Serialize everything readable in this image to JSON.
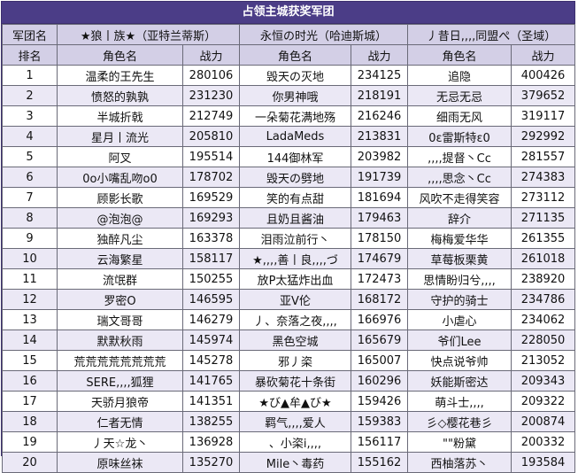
{
  "title": "占领主城获奖军团",
  "header": {
    "corps_label": "军团名",
    "teams": [
      "★狼丨族★（亚特兰蒂斯）",
      "永恒の时光（哈迪斯城）",
      "丿昔日,,,,同盟ぺ（圣域）"
    ]
  },
  "subheader": {
    "rank": "排名",
    "name": "角色名",
    "power": "战力"
  },
  "rows": [
    {
      "rank": "1",
      "a_name": "温柔的王先生",
      "a_power": "280106",
      "b_name": "毁天の灭地",
      "b_power": "234125",
      "c_name": "追隐",
      "c_power": "400426"
    },
    {
      "rank": "2",
      "a_name": "愤怒的孰孰",
      "a_power": "231230",
      "b_name": "你男神哦",
      "b_power": "218191",
      "c_name": "无忌无忌",
      "c_power": "379652"
    },
    {
      "rank": "3",
      "a_name": "半城折戟",
      "a_power": "212749",
      "b_name": "一朵菊花满地殇",
      "b_power": "216246",
      "c_name": "细雨无风",
      "c_power": "319117"
    },
    {
      "rank": "4",
      "a_name": "星月丨流光",
      "a_power": "205810",
      "b_name": "LadaMeds",
      "b_power": "213831",
      "c_name": "0ε雷斯特ε0",
      "c_power": "292992"
    },
    {
      "rank": "5",
      "a_name": "阿叉",
      "a_power": "195514",
      "b_name": "144御林军",
      "b_power": "203982",
      "c_name": ",,,,提督丶Cc",
      "c_power": "281557"
    },
    {
      "rank": "6",
      "a_name": "0o小嘴乱吻o0",
      "a_power": "178702",
      "b_name": "毁天の劈地",
      "b_power": "191739",
      "c_name": ",,,,思念丶Cc",
      "c_power": "274383"
    },
    {
      "rank": "7",
      "a_name": "顾影长歌",
      "a_power": "169529",
      "b_name": "笑的有点甜",
      "b_power": "181694",
      "c_name": "风吹不走得笑容",
      "c_power": "273112"
    },
    {
      "rank": "8",
      "a_name": "@泡泡@",
      "a_power": "169293",
      "b_name": "且奶且酱油",
      "b_power": "179463",
      "c_name": "辞介",
      "c_power": "271135"
    },
    {
      "rank": "9",
      "a_name": "独醉凡尘",
      "a_power": "163378",
      "b_name": "泪雨泣前行丶",
      "b_power": "178150",
      "c_name": "梅梅爱华华",
      "c_power": "261355"
    },
    {
      "rank": "10",
      "a_name": "云海繁星",
      "a_power": "158117",
      "b_name": "★,,,,善丨良,,,,づ",
      "b_power": "174679",
      "c_name": "草莓板栗黄",
      "c_power": "261018"
    },
    {
      "rank": "11",
      "a_name": "流氓群",
      "a_power": "150255",
      "b_name": "放P太猛炸出血",
      "b_power": "172473",
      "c_name": "思情盼归兮,,,,",
      "c_power": "238920"
    },
    {
      "rank": "12",
      "a_name": "罗密O",
      "a_power": "146595",
      "b_name": "亚V伦",
      "b_power": "168172",
      "c_name": "守护的骑士",
      "c_power": "234786"
    },
    {
      "rank": "13",
      "a_name": "瑞文哥哥",
      "a_power": "146279",
      "b_name": "丿、奈落之夜,,,,",
      "b_power": "166976",
      "c_name": "小虐心",
      "c_power": "234062"
    },
    {
      "rank": "14",
      "a_name": "默默秋雨",
      "a_power": "145974",
      "b_name": "黑色空城",
      "b_power": "165679",
      "c_name": "爷们Lee",
      "c_power": "228050"
    },
    {
      "rank": "15",
      "a_name": "荒荒荒荒荒荒荒荒",
      "a_power": "145278",
      "b_name": "邪丿栥",
      "b_power": "165007",
      "c_name": "快点说爷帅",
      "c_power": "213052"
    },
    {
      "rank": "16",
      "a_name": "SERE,,,,狐狸",
      "a_power": "141765",
      "b_name": "暴砍菊花十条街",
      "b_power": "160296",
      "c_name": "妖能斯密达",
      "c_power": "209343"
    },
    {
      "rank": "17",
      "a_name": "天骄月狼帝",
      "a_power": "141351",
      "b_name": "★び▲牟▲び★",
      "b_power": "159426",
      "c_name": "萌斗士,,,,",
      "c_power": "209322"
    },
    {
      "rank": "18",
      "a_name": "仁者无情",
      "a_power": "138255",
      "b_name": "羁气,,,,爱人",
      "b_power": "159383",
      "c_name": "彡◇樱花巷彡",
      "c_power": "200874"
    },
    {
      "rank": "19",
      "a_name": "丿天☆龙丶",
      "a_power": "136928",
      "b_name": "、小栥i,,,,",
      "b_power": "156117",
      "c_name": "\"\"粉黛",
      "c_power": "200332"
    },
    {
      "rank": "20",
      "a_name": "原味丝袜",
      "a_power": "135270",
      "b_name": "Mile丶毒药",
      "b_power": "155162",
      "c_name": "西柚落苏丶",
      "c_power": "193584"
    }
  ]
}
